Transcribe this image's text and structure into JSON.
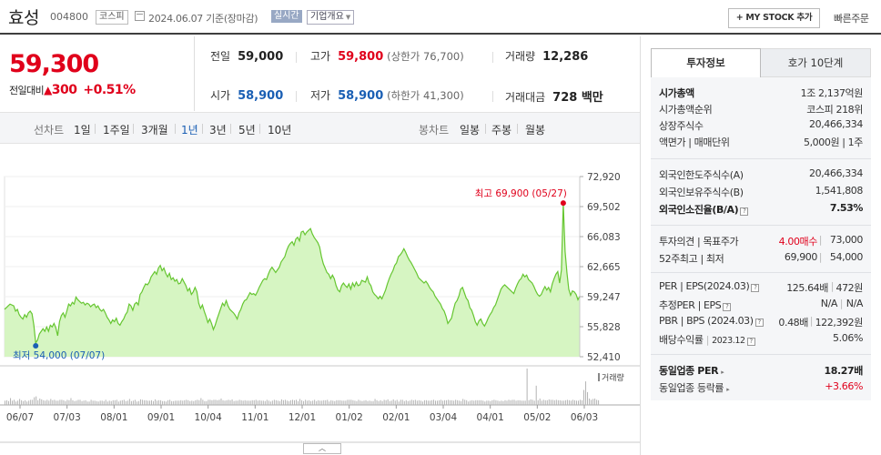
{
  "header": {
    "stock_name": "효성",
    "stock_code": "004800",
    "market": "코스피",
    "date_basis": "2024.06.07 기준(장마감)",
    "realtime_badge": "실시간",
    "company_overview": "기업개요",
    "my_stock_button": "+ MY STOCK 추가",
    "quick_order": "빠른주문"
  },
  "summary": {
    "price": "59,300",
    "change_label": "전일대비",
    "change_arrow": "▲",
    "change_value": "300",
    "change_rate": "+0.51%",
    "prev_close_label": "전일",
    "prev_close": "59,000",
    "high_label": "고가",
    "high": "59,800",
    "upper_limit": "(상한가 76,700)",
    "volume_label": "거래량",
    "volume": "12,286",
    "open_label": "시가",
    "open": "58,900",
    "low_label": "저가",
    "low": "58,900",
    "lower_limit": "(하한가 41,300)",
    "amount_label": "거래대금",
    "amount": "728 백만"
  },
  "chart_tabs": {
    "line_label": "선차트",
    "line_items": [
      "1일",
      "1주일",
      "3개월",
      "1년",
      "3년",
      "5년",
      "10년"
    ],
    "selected": "1년",
    "candle_label": "봉차트",
    "candle_items": [
      "일봉",
      "주봉",
      "월봉"
    ]
  },
  "chart_data": {
    "type": "area",
    "y_ticks": [
      "72,920",
      "69,502",
      "66,083",
      "62,665",
      "59,247",
      "55,828",
      "52,410"
    ],
    "ylim": [
      52410,
      72920
    ],
    "x_ticks": [
      "06/07",
      "07/03",
      "08/01",
      "09/01",
      "10/04",
      "11/01",
      "12/01",
      "01/02",
      "02/01",
      "03/04",
      "04/01",
      "05/02",
      "06/03"
    ],
    "high_annotation": "최고 69,900 (05/27)",
    "low_annotation": "최저 54,000 (07/07)",
    "volume_label": "거래량",
    "values": [
      57800,
      58000,
      58200,
      58400,
      58300,
      58200,
      57600,
      57800,
      57200,
      56900,
      56700,
      57200,
      56900,
      57400,
      57600,
      57300,
      56000,
      54000,
      54300,
      55000,
      55300,
      55600,
      55300,
      55800,
      55300,
      56000,
      55800,
      56200,
      55700,
      54800,
      56400,
      57100,
      57400,
      56900,
      57600,
      58400,
      58200,
      58600,
      58400,
      59200,
      58900,
      58700,
      58500,
      58600,
      58300,
      58500,
      58400,
      58100,
      58300,
      58400,
      58000,
      58200,
      57800,
      57600,
      57800,
      57400,
      56900,
      56600,
      56200,
      56600,
      56400,
      56800,
      56200,
      56000,
      56400,
      56700,
      57200,
      57500,
      58400,
      58200,
      57700,
      58400,
      58600,
      58300,
      59500,
      59800,
      60300,
      60700,
      60600,
      60900,
      61500,
      61800,
      62100,
      61800,
      62500,
      62800,
      62200,
      62500,
      61900,
      61500,
      61900,
      61200,
      61400,
      61000,
      61200,
      60700,
      60800,
      61300,
      60900,
      60500,
      59900,
      60200,
      59500,
      59800,
      60300,
      59800,
      58500,
      57900,
      58300,
      57600,
      57000,
      56300,
      56700,
      56200,
      55500,
      56000,
      56700,
      57300,
      57900,
      58500,
      58200,
      58800,
      58200,
      57800,
      57600,
      57400,
      57100,
      56700,
      57400,
      57800,
      58400,
      58800,
      58900,
      59300,
      59700,
      59500,
      59600,
      59400,
      59800,
      60300,
      60700,
      61100,
      61300,
      61200,
      61800,
      62300,
      62600,
      62300,
      62000,
      62300,
      62600,
      63200,
      63500,
      63800,
      64500,
      65000,
      65300,
      65500,
      65100,
      65800,
      66000,
      65600,
      66600,
      66700,
      66300,
      66600,
      66800,
      67000,
      66400,
      66000,
      65700,
      65400,
      64900,
      63800,
      63000,
      62500,
      62000,
      61800,
      61300,
      61700,
      61300,
      60500,
      60000,
      59800,
      60500,
      60800,
      60500,
      60300,
      60700,
      60100,
      60800,
      60400,
      60900,
      60500,
      60600,
      61100,
      61000,
      60900,
      61500,
      60800,
      60500,
      59800,
      59500,
      59300,
      59000,
      59300,
      59000,
      59500,
      60000,
      60700,
      61300,
      61800,
      62200,
      62800,
      63100,
      63800,
      64000,
      64300,
      64700,
      64300,
      63800,
      63400,
      63100,
      62700,
      62300,
      61900,
      61400,
      61200,
      61000,
      60800,
      61000,
      60700,
      60300,
      60000,
      59800,
      59300,
      59000,
      58700,
      58400,
      57900,
      57600,
      57000,
      56200,
      56500,
      56800,
      57700,
      58500,
      58800,
      59300,
      60100,
      60300,
      59700,
      59100,
      58800,
      58000,
      57700,
      57100,
      56400,
      56000,
      56500,
      56700,
      56200,
      55900,
      56300,
      56800,
      57200,
      57500,
      58000,
      58300,
      58900,
      59500,
      60100,
      60400,
      60600,
      60400,
      60200,
      60000,
      59800,
      59600,
      60200,
      60700,
      61100,
      61300,
      61800,
      61500,
      61700,
      61200,
      61000,
      60800,
      60400,
      59900,
      59500,
      59300,
      59500,
      60000,
      60400,
      60000,
      60300,
      59800,
      60700,
      61300,
      61800,
      62100,
      60800,
      62300,
      69900,
      64400,
      62000,
      60100,
      59400,
      59900,
      59800,
      59500,
      58900,
      59300
    ],
    "volumes": [
      1,
      1.1,
      0.9,
      1.6,
      1,
      1.2,
      0.8,
      1,
      1.4,
      1.1,
      0.9,
      1.1,
      0.8,
      1,
      1.2,
      1.2,
      1.8,
      2,
      1.1,
      1.5,
      1.3,
      1.1,
      1,
      1.2,
      1,
      1.4,
      1.1,
      1.2,
      1,
      1,
      1.2,
      1.2,
      1.1,
      0.9,
      1.2,
      1.1,
      1.6,
      1.1,
      0.9,
      1,
      1.2,
      1.2,
      0.9,
      1,
      1.1,
      0.8,
      0.8,
      1.2,
      1,
      1,
      0.9,
      0.8,
      1,
      1,
      0.9,
      1.2,
      0.8,
      1,
      0.9,
      1.1,
      1.1,
      1.2,
      0.8,
      1,
      1.1,
      1.2,
      0.9,
      1,
      1.4,
      0.9,
      1,
      1.2,
      0.8,
      0.9,
      1.3,
      1.2,
      1.1,
      1.1,
      1,
      1,
      1.1,
      0.9,
      1.3,
      1,
      1.1,
      1.1,
      0.9,
      0.9,
      0.8,
      1.1,
      1.2,
      0.9,
      0.9,
      1,
      1,
      1,
      1.1,
      1,
      1.1,
      1.2,
      1.1,
      0.9,
      1,
      0.9,
      1.1,
      1.2,
      1.1,
      1.6,
      1.2,
      0.9,
      0.9,
      1.2,
      1.2,
      1.1,
      1.2,
      1.2,
      1.1,
      1.2,
      1.5,
      1.1,
      1,
      1.1,
      1.2,
      1.1,
      1.3,
      0.9,
      1,
      1,
      1.2,
      1.1,
      1,
      1.1,
      1,
      1,
      1,
      1.1,
      1.1,
      1.2,
      1,
      1.1,
      1,
      1,
      0.9,
      1.2,
      1,
      0.8,
      1,
      1.2,
      1.1,
      1,
      0.9,
      1.3,
      1.1,
      1.2,
      1,
      0.9,
      1.1,
      1.2,
      1.1,
      1.2,
      0.9,
      1.4,
      1.1,
      0.9,
      1.2,
      1,
      1.1,
      0.9,
      1,
      1.2,
      0.9,
      1.1,
      1,
      1,
      1.1,
      1.1,
      1.2,
      0.8,
      1.1,
      1,
      0.9,
      1.1,
      1.1,
      1.1,
      1,
      1,
      1,
      1.2,
      1.2,
      1.2,
      1.1,
      1,
      0.9,
      1.2,
      1,
      0.9,
      1,
      1.1,
      0.9,
      1,
      0.9,
      0.9,
      1.4,
      1.1,
      0.9,
      1.1,
      0.9,
      1.2,
      1.1,
      1.3,
      0.9,
      1,
      1.3,
      1,
      1.2,
      0.8,
      1.2,
      1.2,
      0.9,
      1.1,
      0.9,
      1,
      1.2,
      1.1,
      1.2,
      1,
      1.1,
      1,
      0.8,
      1.1,
      1.1,
      1,
      1,
      1.1,
      1.2,
      1,
      1,
      1.1,
      1.2,
      1,
      1.1,
      1.1,
      1.2,
      1.1,
      1.1,
      1,
      1.2,
      1.1,
      1,
      0.9,
      1.4,
      1.2,
      1.1,
      0.8,
      1,
      1.1,
      1,
      1.1,
      1.1,
      1.1,
      1.1,
      1,
      0.8,
      1,
      1,
      0.9,
      1.1,
      1.2,
      1.1,
      1,
      0.9,
      1,
      0.9,
      1.1,
      1,
      1.2,
      1.1,
      1.2,
      1.2,
      1,
      1.1,
      1.1,
      1,
      1,
      1,
      8.5,
      1.1,
      1.3,
      1.2,
      1,
      4.5,
      1.1,
      1.5,
      1,
      1.2,
      1.1,
      1.1,
      1.3,
      1.2,
      1.2,
      1.1,
      1.2,
      1.1,
      1.1,
      1,
      1,
      1.1,
      1.2,
      1.1,
      1,
      1.2,
      1.1,
      1,
      1,
      1.2,
      1.1,
      3.5,
      5.5,
      3,
      1.5,
      1.2,
      1.4,
      1.5,
      1.2,
      1.1
    ]
  },
  "right_panel": {
    "tab_active": "투자정보",
    "tab_inactive": "호가 10단계",
    "market_cap_label": "시가총액",
    "market_cap_value": "1조 2,137억원",
    "market_cap_rank_label": "시가총액순위",
    "market_cap_rank_value": "코스피 218위",
    "shares_label": "상장주식수",
    "shares_value": "20,466,334",
    "par_unit_label": "액면가 | 매매단위",
    "par_unit_value": "5,000원 | 1주",
    "foreign_limit_label": "외국인한도주식수(A)",
    "foreign_limit_value": "20,466,334",
    "foreign_hold_label": "외국인보유주식수(B)",
    "foreign_hold_value": "1,541,808",
    "foreign_ratio_label": "외국인소진율(B/A)",
    "foreign_ratio_value": "7.53%",
    "opinion_label": "투자의견 | 목표주가",
    "opinion_value": "4.00매수",
    "target_value": "73,000",
    "week52_label": "52주최고 | 최저",
    "week52_high": "69,900",
    "week52_low": "54,000",
    "per_eps_label": "PER | EPS(2024.03)",
    "per_value": "125.64배",
    "eps_value": "472원",
    "est_per_eps_label": "추정PER | EPS",
    "est_per_value": "N/A",
    "est_eps_value": "N/A",
    "pbr_bps_label": "PBR | BPS (2024.03)",
    "pbr_value": "0.48배",
    "bps_value": "122,392원",
    "dividend_label": "배당수익률",
    "dividend_period": "2023.12",
    "dividend_value": "5.06%",
    "sector_per_label": "동일업종 PER",
    "sector_per_value": "18.27배",
    "sector_rate_label": "동일업종 등락률",
    "sector_rate_value": "+3.66%",
    "help_icon_glyph": "?"
  },
  "colors": {
    "up_red": "#e0001b",
    "down_blue": "#1a5fb4",
    "chart_line": "#66c631",
    "chart_fill": "#d6f5c2"
  }
}
